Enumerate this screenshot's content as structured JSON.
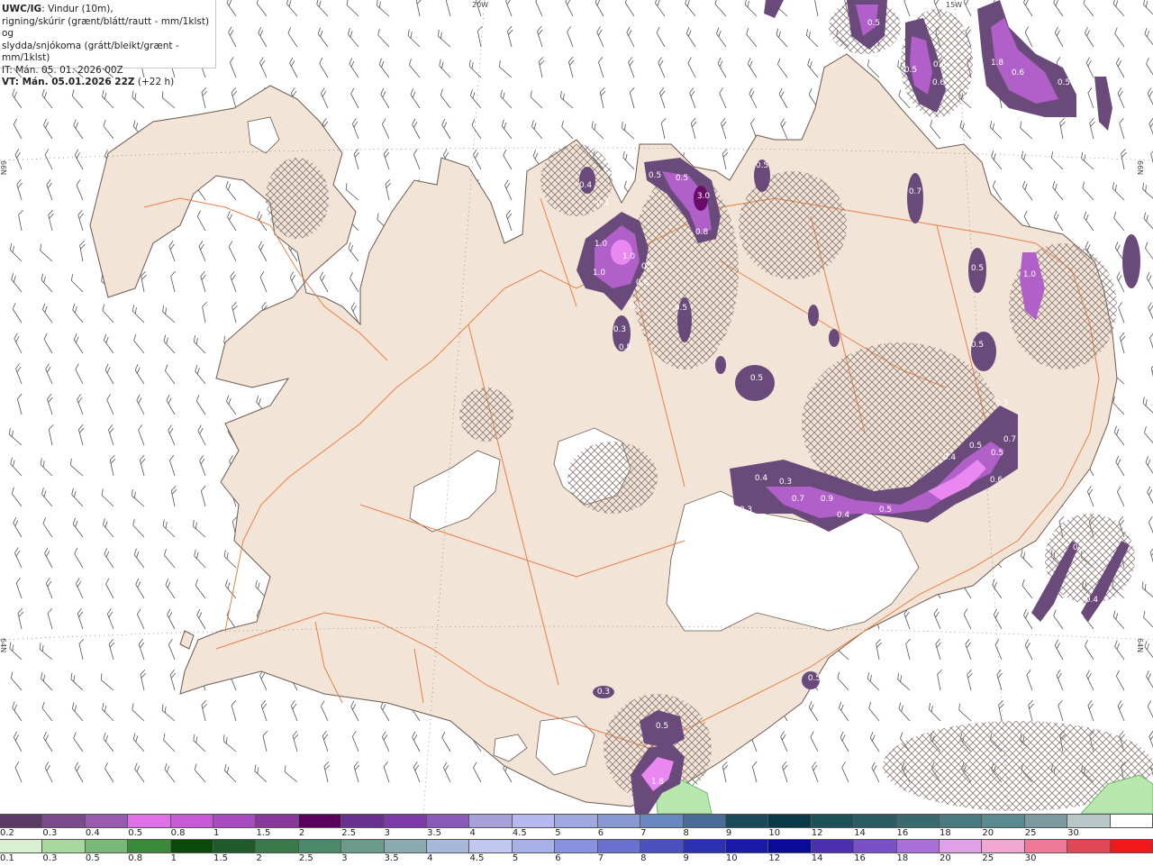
{
  "header": {
    "product": "UWC/IG",
    "line1_rest": ": Vindur (10m),",
    "line2": "rigning/skúrir (grænt/blátt/rautt - mm/1klst) og",
    "line3": "slydda/snjókoma (grátt/bleikt/grænt - mm/1klst)",
    "it_line": "IT: Mán. 05. 01. 2026 00Z",
    "vt_bold": "VT: Mán. 05.01.2026 22Z",
    "vt_rest": " (+22 h)"
  },
  "grid_labels": {
    "top_20w": "20W",
    "top_15w": "15W",
    "left_66n": "66N",
    "right_66n": "66N",
    "left_64n": "64N",
    "right_64n": "64N"
  },
  "precip_labels": [
    {
      "text": "0.5"
    },
    {
      "text": "0.6"
    },
    {
      "text": "0.6"
    },
    {
      "text": "0.5"
    },
    {
      "text": "1.8"
    },
    {
      "text": "0.6"
    },
    {
      "text": "0.5"
    },
    {
      "text": "0.4"
    },
    {
      "text": "0.4"
    },
    {
      "text": "0.5"
    },
    {
      "text": "0.5"
    },
    {
      "text": "3.0"
    },
    {
      "text": "0.8"
    },
    {
      "text": "0.5"
    },
    {
      "text": "0.7"
    },
    {
      "text": "1.0"
    },
    {
      "text": "1.0"
    },
    {
      "text": "1.0"
    },
    {
      "text": "0.5"
    },
    {
      "text": "0.6"
    },
    {
      "text": "0.4"
    },
    {
      "text": "0.3"
    },
    {
      "text": "0.5"
    },
    {
      "text": "0.5"
    },
    {
      "text": "0.5"
    },
    {
      "text": "1.0"
    },
    {
      "text": "0.5"
    },
    {
      "text": "0.5"
    },
    {
      "text": "0.4"
    },
    {
      "text": "0.3"
    },
    {
      "text": "0.7"
    },
    {
      "text": "0.9"
    },
    {
      "text": "0.4"
    },
    {
      "text": "0.5"
    },
    {
      "text": "0.3"
    },
    {
      "text": "0.5"
    },
    {
      "text": "0.4"
    },
    {
      "text": "0.5"
    },
    {
      "text": "0.7"
    },
    {
      "text": "0.6"
    },
    {
      "text": "0.3"
    },
    {
      "text": "0.4"
    },
    {
      "text": "0.5"
    },
    {
      "text": "0.3"
    },
    {
      "text": "0.5"
    },
    {
      "text": "1.8"
    },
    {
      "text": "0.5"
    }
  ],
  "legend_snow": {
    "colors": [
      "#5b3a66",
      "#7a4a8a",
      "#9a5ab0",
      "#e070e8",
      "#c85ad8",
      "#a84ac0",
      "#88389a",
      "#58005c",
      "#6a3090",
      "#7e3aa8",
      "#8a5ab8",
      "#a8a0d8",
      "#b8b8f0",
      "#a0a8e0",
      "#8898d0",
      "#6a88c0",
      "#4a6a98",
      "#1a4a5a",
      "#0a3a48",
      "#1e5058",
      "#2a5a62",
      "#3a6a70",
      "#4a7a80",
      "#5a8a90",
      "#7a9aa0",
      "#b8c8c8",
      "#ffffff"
    ],
    "labels": [
      "0.2",
      "0.3",
      "0.4",
      "0.5",
      "0.8",
      "1",
      "1.5",
      "2",
      "2.5",
      "3",
      "3.5",
      "4",
      "4.5",
      "5",
      "6",
      "7",
      "8",
      "9",
      "10",
      "12",
      "14",
      "16",
      "18",
      "20",
      "25",
      "30"
    ]
  },
  "legend_rain": {
    "colors": [
      "#d8f0d0",
      "#a8d8a0",
      "#78b878",
      "#3a8a3a",
      "#0a4a0a",
      "#1e5a2a",
      "#3a7a4a",
      "#4a8a6a",
      "#6a9a8a",
      "#8aaab0",
      "#a8b8d8",
      "#c0c8f0",
      "#a8b0e8",
      "#8890e0",
      "#6a70d0",
      "#4a50c0",
      "#2a30b0",
      "#1a1aa8",
      "#0a0a98",
      "#4a30b0",
      "#7a50c8",
      "#a870d8",
      "#e0a0e8",
      "#f0a8d0",
      "#f07898",
      "#e04858",
      "#f01818"
    ],
    "labels": [
      "0.1",
      "0.3",
      "0.5",
      "0.8",
      "1",
      "1.5",
      "2",
      "2.5",
      "3",
      "3.5",
      "4",
      "4.5",
      "5",
      "6",
      "7",
      "8",
      "9",
      "10",
      "12",
      "14",
      "16",
      "18",
      "20",
      "25",
      "30"
    ]
  },
  "colors": {
    "land": "#f2e4d6",
    "land_outline": "#6a5a50",
    "roads": "#e8804a",
    "glacier": "#ffffff",
    "snow_light": "#7a4a8a",
    "snow_mid": "#b060c8",
    "snow_heavy": "#e888f0",
    "snow_core": "#6a0a6a",
    "rain_light": "#b8e8b0"
  }
}
